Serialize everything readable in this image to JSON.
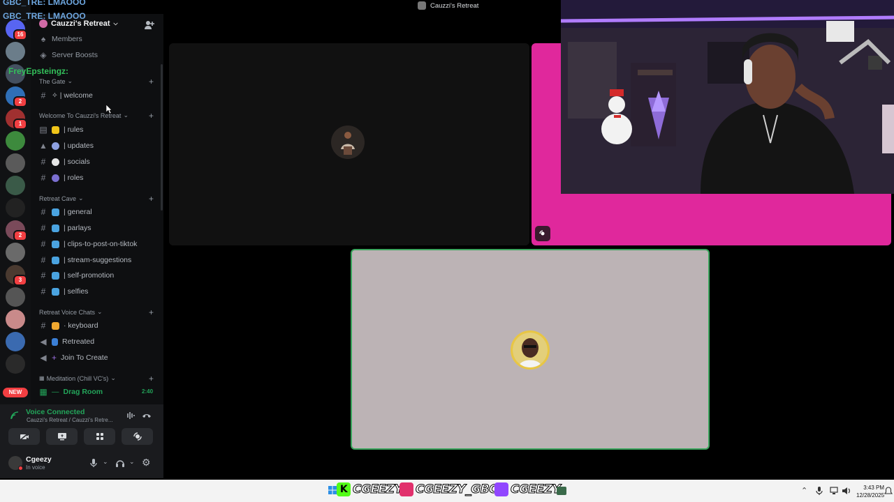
{
  "window_title": "Cauzzi's Retreat",
  "overlay": {
    "line1": "GBC_TRE: LMAOOO",
    "line2": "GBC_TRE: LMAOOO",
    "line3": "FreyEpsteingz:"
  },
  "server": {
    "name": "Cauzzi's Retreat",
    "menu": {
      "members": "Members",
      "boosts": "Server Boosts"
    }
  },
  "rail": {
    "badges": [
      "16",
      "2",
      "1",
      "2",
      "3"
    ],
    "new_label": "NEW"
  },
  "categories": [
    {
      "name": "The Gate",
      "channels": [
        {
          "name": "✧ | welcome"
        }
      ]
    },
    {
      "name": "Welcome To Cauzzi's Retreat",
      "channels": [
        {
          "name": "| rules"
        },
        {
          "name": "| updates"
        },
        {
          "name": "| socials"
        },
        {
          "name": "| roles"
        }
      ]
    },
    {
      "name": "Retreat Cave",
      "channels": [
        {
          "name": "| general"
        },
        {
          "name": "| parlays"
        },
        {
          "name": "| clips-to-post-on-tiktok"
        },
        {
          "name": "| stream-suggestions"
        },
        {
          "name": "| self-promotion"
        },
        {
          "name": "| selfies"
        }
      ]
    },
    {
      "name": "Retreat Voice Chats",
      "channels": [
        {
          "name": "· keyboard"
        },
        {
          "name": "Retreated"
        },
        {
          "name": "Join To Create"
        }
      ]
    },
    {
      "name": "Meditation (Chill VC's)",
      "channels": [
        {
          "name": "Drag Room",
          "time": "2:40"
        }
      ]
    }
  ],
  "voice": {
    "status": "Voice Connected",
    "location": "Cauzzi's Retreat / Cauzzi's Retre..."
  },
  "user": {
    "name": "Cgeezy",
    "status": "In voice"
  },
  "socials": [
    {
      "platform": "kick",
      "handle": "CGEEZY",
      "color": "#53fc18"
    },
    {
      "platform": "instagram",
      "handle": "CGEEZY_GBC",
      "color": "#e1306c"
    },
    {
      "platform": "twitch",
      "handle": "CGEEZY",
      "color": "#9146ff"
    }
  ],
  "clock": {
    "time": "3:43 PM",
    "date": "12/28/2025"
  },
  "colors": {
    "accent_pink": "#e0289c",
    "voice_green": "#23a55a",
    "speaking_border": "#3ba55d"
  }
}
